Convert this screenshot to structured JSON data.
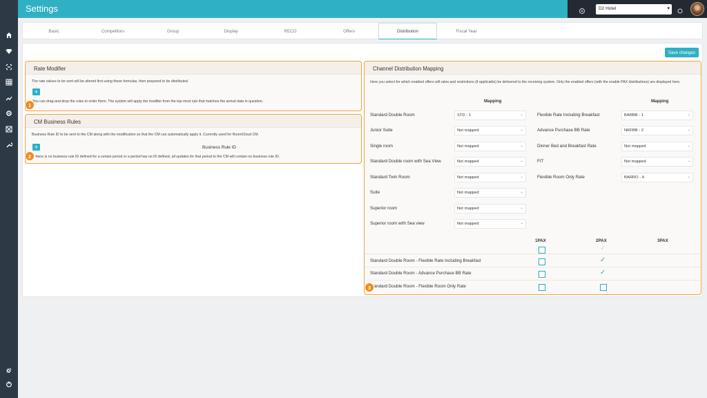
{
  "header": {
    "title": "Settings",
    "hotel": "D2 Hotel"
  },
  "sidebar": {
    "icons": [
      "home-icon",
      "diamond-icon",
      "tag-icon",
      "calendar-grid-icon",
      "trend-icon",
      "cog-icon",
      "image-icon",
      "wrench-icon"
    ],
    "bottom_icons": [
      "plug-icon",
      "power-icon"
    ]
  },
  "tabs": [
    "Basic",
    "Competitors",
    "Group",
    "Display",
    "RECO",
    "Offers",
    "Distribution",
    "Fiscal Year"
  ],
  "active_tab": "Distribution",
  "save_label": "Save changes",
  "rate_modifier": {
    "title": "Rate Modifier",
    "desc": "The rate values to be sent will be altered first using these formulas, then prepared to be distributed.",
    "drag_hint": "You can drag-and-drop the rules to order them. The system will apply the modifier from the top-most rule that matches the arrival date in question.",
    "badge": "1"
  },
  "cm_rules": {
    "title": "CM Business Rules",
    "desc": "Business Rule ID to be sent to the CM along with the modification so that the CM can automatically apply it. Currently used for RoomCloud CM.",
    "col": "Business Rule ID",
    "note": "If there is no business rule ID defined for a certain period or a period has no ID defined, all updates for that period to the CM will contain no business rule ID.",
    "badge": "2"
  },
  "channel": {
    "title": "Channel Distribution Mapping",
    "desc": "Here you select for which enabled offers will rates and restrictions (if applicable) be delivered to the receiving system. Only the enabled offers (with the enable PAX distributions) are displayed here.",
    "mapping_label": "Mapping",
    "rooms": [
      {
        "name": "Standard Double Room",
        "value": "STD - 1"
      },
      {
        "name": "Junior Suite",
        "value": "Not mapped"
      },
      {
        "name": "Single room",
        "value": "Not mapped"
      },
      {
        "name": "Standard Double room with Sea View",
        "value": "Not mapped"
      },
      {
        "name": "Standard Twin Room",
        "value": "Not mapped"
      },
      {
        "name": "Suite",
        "value": "Not mapped"
      },
      {
        "name": "Superior room",
        "value": "Not mapped"
      },
      {
        "name": "Superior room with Sea view",
        "value": "Not mapped"
      }
    ],
    "offers": [
      {
        "name": "Flexible Rate Including Breakfast",
        "value": "BARBB - 1"
      },
      {
        "name": "Advance Purchase BB Rate",
        "value": "NRFBB - 2"
      },
      {
        "name": "Dinner Bed and Breakfast Rate",
        "value": "Not mapped"
      },
      {
        "name": "FIT",
        "value": "Not mapped"
      },
      {
        "name": "Flexible Room Only Rate",
        "value": "BARRO - 4"
      }
    ],
    "pax_headers": [
      "1PAX",
      "2PAX",
      "3PAX"
    ],
    "pax_rows": [
      {
        "name": "Standard Double Room - Flexible Rate Including Breakfast",
        "p1": false,
        "p2": true
      },
      {
        "name": "Standard Double Room - Advance Purchase BB Rate",
        "p1": false,
        "p2": true
      },
      {
        "name": "Standard Double Room - Flexible Room Only Rate",
        "p1": false,
        "p2": false
      }
    ],
    "badge": "3"
  }
}
